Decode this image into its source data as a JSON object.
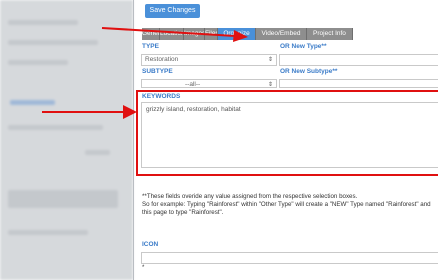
{
  "toolbar": {
    "save_label": "Save Changes"
  },
  "tabs": [
    {
      "label": "General"
    },
    {
      "label": "Location"
    },
    {
      "label": "Images"
    },
    {
      "label": "Files"
    },
    {
      "label": "Organize"
    },
    {
      "label": "Video/Embed"
    },
    {
      "label": "Project Info"
    }
  ],
  "form": {
    "type_label": "TYPE",
    "type_value": "Restoration",
    "new_type_label": "OR New Type**",
    "subtype_label": "SUBTYPE",
    "subtype_value": "--all--",
    "new_subtype_label": "OR New Subtype**",
    "keywords_label": "KEYWORDS",
    "keywords_value": "grizzly island, restoration, habitat",
    "icon_label": "ICON"
  },
  "notes": {
    "line1": "**These fields overide any value assigned from the respective selection boxes.",
    "line2": "So for example: Typing \"Rainforest\" within \"Other Type\" will create a \"NEW\" Type named \"Rainforest\" and",
    "line3": "this page to type \"Rainforest\"."
  },
  "icons": {
    "select_arrows": "up-down-arrows-icon",
    "callout": "red-arrow-icon"
  },
  "colors": {
    "accent": "#4a90d9",
    "tab_inactive": "#8e8e8e",
    "highlight": "#e01010",
    "label": "#3a7bc8"
  }
}
